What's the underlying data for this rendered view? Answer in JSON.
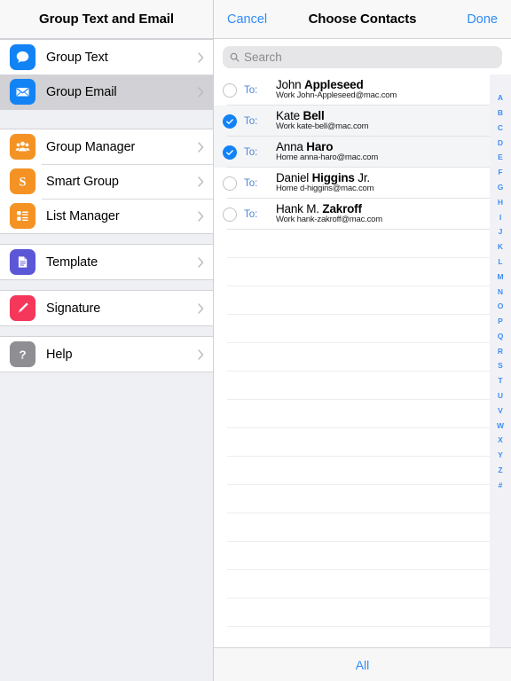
{
  "sidebar": {
    "title": "Group Text and Email",
    "sections": [
      {
        "items": [
          {
            "label": "Group Text",
            "icon": "chat-bubble-icon",
            "color": "#1283f5",
            "selected": false
          },
          {
            "label": "Group Email",
            "icon": "envelope-icon",
            "color": "#1283f5",
            "selected": true
          }
        ]
      },
      {
        "items": [
          {
            "label": "Group Manager",
            "icon": "people-group-icon",
            "color": "#f49324",
            "selected": false
          },
          {
            "label": "Smart Group",
            "icon": "s-badge-icon",
            "color": "#f49324",
            "selected": false
          },
          {
            "label": "List Manager",
            "icon": "list-icon",
            "color": "#f49324",
            "selected": false
          }
        ]
      },
      {
        "items": [
          {
            "label": "Template",
            "icon": "document-icon",
            "color": "#5b57d6",
            "selected": false
          }
        ]
      },
      {
        "items": [
          {
            "label": "Signature",
            "icon": "pen-icon",
            "color": "#f4375a",
            "selected": false
          }
        ]
      },
      {
        "items": [
          {
            "label": "Help",
            "icon": "question-mark-icon",
            "color": "#8e8e93",
            "selected": false
          }
        ]
      }
    ]
  },
  "panel": {
    "cancel_label": "Cancel",
    "title": "Choose Contacts",
    "done_label": "Done",
    "search": {
      "value": "",
      "placeholder": "Search",
      "icon": "search-icon"
    },
    "contacts": [
      {
        "checked": false,
        "to_label": "To:",
        "first": "John ",
        "last": "Appleseed",
        "suffix": "",
        "detail": "Work John-Appleseed@mac.com"
      },
      {
        "checked": true,
        "to_label": "To:",
        "first": "Kate ",
        "last": "Bell",
        "suffix": "",
        "detail": "Work kate-bell@mac.com"
      },
      {
        "checked": true,
        "to_label": "To:",
        "first": "Anna ",
        "last": "Haro",
        "suffix": "",
        "detail": "Home anna-haro@mac.com"
      },
      {
        "checked": false,
        "to_label": "To:",
        "first": "Daniel ",
        "last": "Higgins",
        "suffix": " Jr.",
        "detail": "Home d-higgins@mac.com"
      },
      {
        "checked": false,
        "to_label": "To:",
        "first": "Hank M. ",
        "last": "Zakroff",
        "suffix": "",
        "detail": "Work hank-zakroff@mac.com"
      }
    ],
    "empty_row_count": 15,
    "index_letters": [
      "A",
      "B",
      "C",
      "D",
      "E",
      "F",
      "G",
      "H",
      "I",
      "J",
      "K",
      "L",
      "M",
      "N",
      "O",
      "P",
      "Q",
      "R",
      "S",
      "T",
      "U",
      "V",
      "W",
      "X",
      "Y",
      "Z",
      "#"
    ],
    "footer_label": "All"
  },
  "colors": {
    "accent_blue": "#2f8bf7",
    "check_blue": "#1283f5",
    "index_blue": "#3d8ef5",
    "to_blue": "#4a86d8",
    "selected_row": "#d2d2d6"
  }
}
